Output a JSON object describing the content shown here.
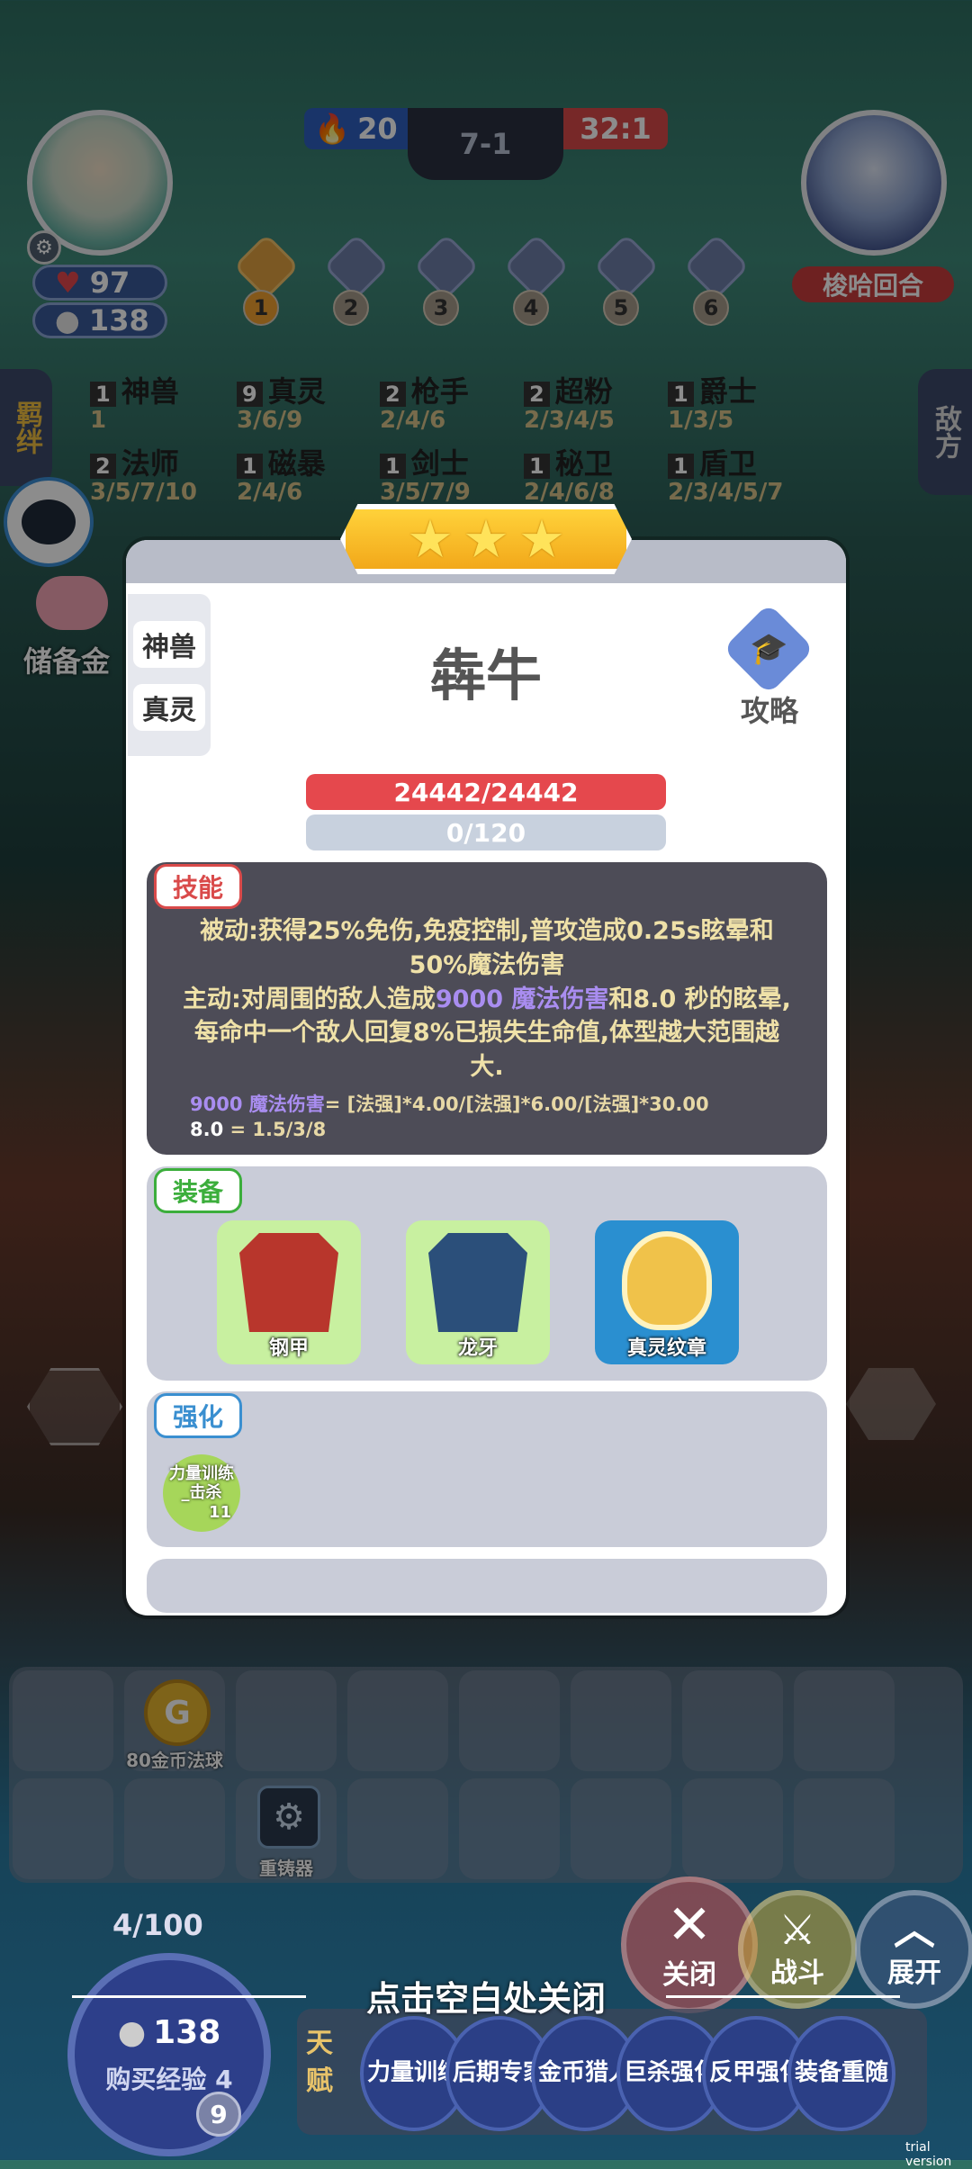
{
  "top_bar": {
    "player_hp": "97",
    "player_gold": "138",
    "streak_count": "20",
    "round": "7-1",
    "enemy_score": "32:1",
    "enemy_name": "梭哈回合",
    "round_nodes": [
      "1",
      "2",
      "3",
      "4",
      "5",
      "6"
    ]
  },
  "side_tabs": {
    "left": "羁绊",
    "right": "敌方"
  },
  "traits": [
    {
      "count": "1",
      "name": "神兽",
      "tiers": "1"
    },
    {
      "count": "9",
      "name": "真灵",
      "tiers": "3/6/9"
    },
    {
      "count": "2",
      "name": "枪手",
      "tiers": "2/4/6"
    },
    {
      "count": "2",
      "name": "超粉",
      "tiers": "2/3/4/5"
    },
    {
      "count": "1",
      "name": "爵士",
      "tiers": "1/3/5"
    },
    {
      "count": "2",
      "name": "法师",
      "tiers": "3/5/7/10"
    },
    {
      "count": "1",
      "name": "磁暴",
      "tiers": "2/4/6"
    },
    {
      "count": "1",
      "name": "剑士",
      "tiers": "3/5/7/9"
    },
    {
      "count": "1",
      "name": "秘卫",
      "tiers": "2/4/6/8"
    },
    {
      "count": "1",
      "name": "盾卫",
      "tiers": "2/3/4/5/7"
    }
  ],
  "savings_label": "储备金",
  "unit": {
    "name": "犇牛",
    "stars": 3,
    "types": [
      "神兽",
      "真灵"
    ],
    "guide_label": "攻略",
    "hp": "24442/24442",
    "hp_ratio": 1.0,
    "mana": "0/120",
    "mana_ratio": 0.0
  },
  "skill": {
    "tag": "技能",
    "passive": "被动:获得25%免伤,免疫控制,普攻造成0.25s眩晕和50%魔法伤害",
    "active_prefix": "主动:对周围的敌人造成",
    "active_damage": "9000 魔法伤害",
    "active_mid": "和",
    "active_stun": "8.0",
    "active_suffix": " 秒的眩晕,每命中一个敌人回复8%已损失生命值,体型越大范围越大.",
    "formula1_a": "9000 魔法伤害",
    "formula1_b": "= [法强]*4.00/[法强]*6.00/[法强]*30.00",
    "formula2_a": "8.0",
    "formula2_b": " = 1.5/3/8"
  },
  "equipment": {
    "tag": "装备",
    "items": [
      {
        "name": "钢甲",
        "bg": "#c8f0a0"
      },
      {
        "name": "龙牙",
        "bg": "#c8f0a0"
      },
      {
        "name": "真灵纹章",
        "bg": "#2a8fd0"
      }
    ]
  },
  "enhance": {
    "tag": "强化",
    "item_line1": "力量训练",
    "item_line2": "_击杀",
    "item_count": "11"
  },
  "bench": {
    "item1": "80金币法球",
    "item2": "重铸器"
  },
  "actions": {
    "close": "关闭",
    "fight": "战斗",
    "expand": "展开"
  },
  "level": {
    "xp": "4/100",
    "gold": "138",
    "buy_xp": "购买经验 4",
    "level_num": "9"
  },
  "talent_label": "天赋",
  "talents": [
    "力量训练",
    "后期专家",
    "金币猎人",
    "巨杀强化",
    "反甲强化",
    "装备重随"
  ],
  "close_hint": "点击空白处关闭",
  "trial": "trial version"
}
